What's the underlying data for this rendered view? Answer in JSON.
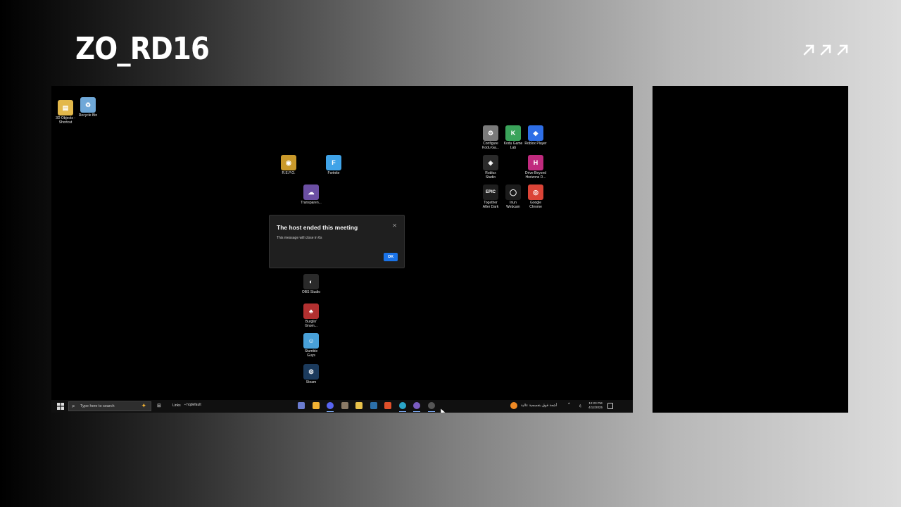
{
  "overlay": {
    "title": "ZO_RD16"
  },
  "desktop": {
    "icons": [
      {
        "id": "3d-objects",
        "label": "3D Objects -\nShortcut",
        "color": "#e3b84a",
        "glyph": "▤"
      },
      {
        "id": "recycle-bin",
        "label": "Recycle Bin",
        "color": "#6fa8d8",
        "glyph": "♻"
      },
      {
        "id": "repo",
        "label": "R.E.P.O.",
        "color": "#c9992b",
        "glyph": "◉"
      },
      {
        "id": "fortnite",
        "label": "Fortnite",
        "color": "#3fa3e8",
        "glyph": "F"
      },
      {
        "id": "transparent",
        "label": "Transparen...",
        "color": "#6b4fa3",
        "glyph": "☁"
      },
      {
        "id": "configure-kodu",
        "label": "Configure\nKodu Ga...",
        "color": "#7a7a7a",
        "glyph": "⚙"
      },
      {
        "id": "kodu-game-lab",
        "label": "Kodu Game\nLab",
        "color": "#3aa35a",
        "glyph": "K"
      },
      {
        "id": "roblox-player",
        "label": "Roblox Player",
        "color": "#2e6ee6",
        "glyph": "◆"
      },
      {
        "id": "roblox-studio",
        "label": "Roblox\nStudio",
        "color": "#2a2a2a",
        "glyph": "◈"
      },
      {
        "id": "drive-beyond",
        "label": "Drive Beyond\nHorizons D...",
        "color": "#c02a7e",
        "glyph": "H"
      },
      {
        "id": "epic-games",
        "label": "Together\nAfter Dark",
        "color": "#1e1e1e",
        "glyph": "EPIC"
      },
      {
        "id": "iriun-webcam",
        "label": "Iriun\nWebcam",
        "color": "#1b1b1b",
        "glyph": "◯"
      },
      {
        "id": "google-chrome",
        "label": "Google\nChrome",
        "color": "#db4437",
        "glyph": "◎"
      },
      {
        "id": "obs-studio",
        "label": "OBS Studio",
        "color": "#2a2a2a",
        "glyph": "◐"
      },
      {
        "id": "burglin-gnomes",
        "label": "Burglin'\nGnom...",
        "color": "#b23030",
        "glyph": "♣"
      },
      {
        "id": "stumble-guys",
        "label": "Stumble\nGuys",
        "color": "#48a0d8",
        "glyph": "☺"
      },
      {
        "id": "steam",
        "label": "Steam",
        "color": "#1b3a5c",
        "glyph": "⚙"
      }
    ]
  },
  "dialog": {
    "title": "The host ended this meeting",
    "message": "This message will close in 6s",
    "ok_label": "OK",
    "close_glyph": "✕"
  },
  "taskbar": {
    "search_placeholder": "Type here to search",
    "links_label": "Links",
    "folder_label": "hqdefault",
    "pinned_apps": [
      {
        "id": "app-1",
        "color": "#6b7cd0"
      },
      {
        "id": "app-2",
        "color": "#f2b233"
      },
      {
        "id": "discord",
        "color": "#5865f2"
      },
      {
        "id": "app-4",
        "color": "#8a7a66"
      },
      {
        "id": "file-explorer",
        "color": "#e8c14a"
      },
      {
        "id": "steam",
        "color": "#2c6fa8"
      },
      {
        "id": "app-7",
        "color": "#e0502a"
      },
      {
        "id": "edge",
        "color": "#2aa6c9"
      },
      {
        "id": "app-9",
        "color": "#7a5cc0"
      },
      {
        "id": "obs",
        "color": "#555555"
      }
    ],
    "news_text": "أشعة فوق بنفسجية عالية",
    "language": "ع",
    "time": "12:23 PM",
    "date": "4/12/2025"
  },
  "colors": {
    "dialog_bg": "#1f1f1f",
    "accent": "#1a73e8",
    "taskbar_bg": "#101010"
  }
}
